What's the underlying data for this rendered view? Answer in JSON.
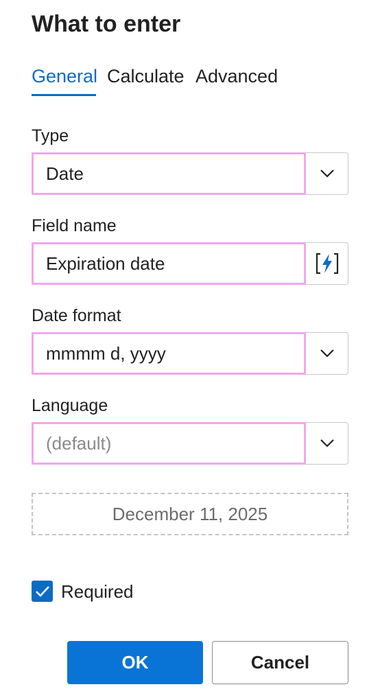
{
  "dialog": {
    "title": "What to enter"
  },
  "tabs": [
    {
      "label": "General",
      "active": true
    },
    {
      "label": "Calculate",
      "active": false
    },
    {
      "label": "Advanced",
      "active": false
    }
  ],
  "type": {
    "label": "Type",
    "value": "Date",
    "icon": "chevron-down-icon"
  },
  "field_name": {
    "label": "Field name",
    "value": "Expiration date",
    "icon": "insert-field-icon"
  },
  "date_format": {
    "label": "Date format",
    "value": "mmmm d, yyyy",
    "icon": "chevron-down-icon"
  },
  "language": {
    "label": "Language",
    "placeholder": "(default)",
    "icon": "chevron-down-icon"
  },
  "preview": {
    "value": "December 11, 2025"
  },
  "required": {
    "label": "Required",
    "checked": true
  },
  "buttons": {
    "ok": "OK",
    "cancel": "Cancel"
  },
  "colors": {
    "accent": "#0a6cc4",
    "ok_button": "#0a74d6",
    "field_highlight": "#f3a6ee"
  }
}
